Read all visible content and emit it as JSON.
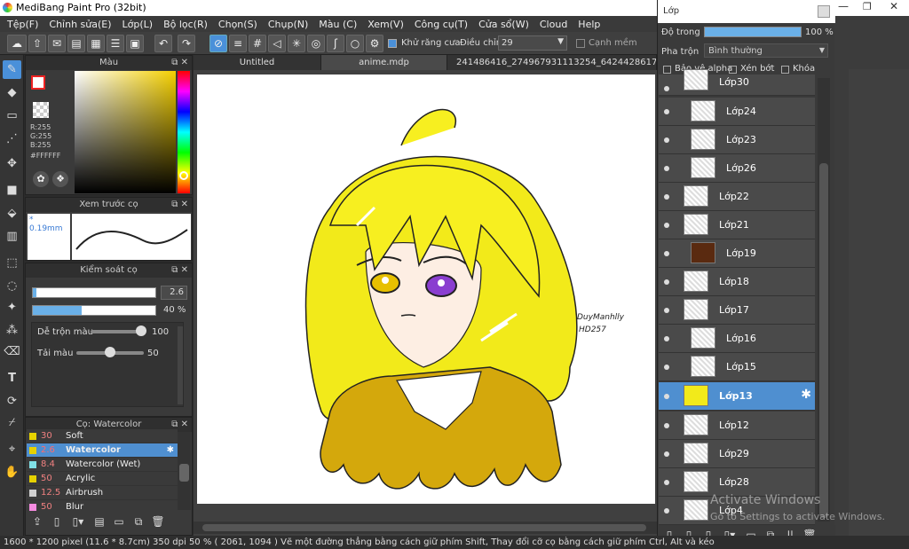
{
  "app": {
    "title": "MediBang Paint Pro (32bit)"
  },
  "menu": [
    "Tệp(F)",
    "Chỉnh sửa(E)",
    "Lớp(L)",
    "Bộ lọc(R)",
    "Chọn(S)",
    "Chụp(N)",
    "Màu (C)",
    "Xem(V)",
    "Công cụ(T)",
    "Cửa sổ(W)",
    "Cloud",
    "Help"
  ],
  "toolbar": {
    "antialias_label": "Khử răng cưa",
    "adjust_label": "Điều chỉnh",
    "adjust_value": "29",
    "soft_edge_label": "Cạnh mềm"
  },
  "color_panel": {
    "title": "Màu",
    "r": "R:255",
    "g": "G:255",
    "b": "B:255",
    "hex": "#FFFFFF"
  },
  "preview_panel": {
    "title": "Xem trước cọ",
    "size": "0.19mm"
  },
  "brush_control": {
    "title": "Kiểm soát cọ",
    "size_value": "2.6",
    "opacity_value": "40 %",
    "mix_label": "Dễ trộn màu",
    "mix_value": "100",
    "paint_label": "Tải màu",
    "paint_value": "50"
  },
  "brush_panel": {
    "title": "Cọ: Watercolor",
    "rows": [
      {
        "size": "30",
        "name": "Soft",
        "color": "#e6d200"
      },
      {
        "size": "2.6",
        "name": "Watercolor",
        "color": "#e6d200",
        "selected": true
      },
      {
        "size": "8.4",
        "name": "Watercolor (Wet)",
        "color": "#7fe0e6"
      },
      {
        "size": "50",
        "name": "Acrylic",
        "color": "#e6d200"
      },
      {
        "size": "12.5",
        "name": "Airbrush",
        "color": "#cfcfcf"
      },
      {
        "size": "50",
        "name": "Blur",
        "color": "#f58be0"
      }
    ]
  },
  "tabs": [
    "Untitled",
    "anime.mdp",
    "241486416_274967931113254_6424428617291316811_n.j"
  ],
  "canvas": {
    "signature_line1": "DuyManhlly",
    "signature_line2": "HD257"
  },
  "layer_panel": {
    "title": "Lớp",
    "opacity_label": "Độ trong",
    "opacity_value": "100 %",
    "blend_label": "Pha trộn",
    "blend_value": "Bình thường",
    "protect_alpha": "Bảo vệ alpha",
    "clipping": "Xén bớt",
    "lock": "Khóa",
    "layers": [
      "Lớp30",
      "Lớp24",
      "Lớp23",
      "Lớp26",
      "Lớp22",
      "Lớp21",
      "Lớp19",
      "Lớp18",
      "Lớp17",
      "Lớp16",
      "Lớp15",
      "Lớp13",
      "Lớp12",
      "Lớp29",
      "Lớp28",
      "Lớp4"
    ]
  },
  "status": {
    "text": "1600 * 1200 pixel  (11.6 * 8.7cm)  350 dpi  50 %  ( 2061, 1094 )  Vẽ một đường thẳng bằng cách giữ phím Shift, Thay đổi cỡ cọ bằng cách giữ phím Ctrl, Alt và kéo"
  },
  "watermark": {
    "line1": "Activate Windows",
    "line2": "Go to Settings to activate Windows."
  },
  "colors": {
    "accent": "#4f8fd0",
    "hair": "#f2ea1a",
    "sweater": "#d4a80c",
    "bg": "#2b2b2b"
  }
}
